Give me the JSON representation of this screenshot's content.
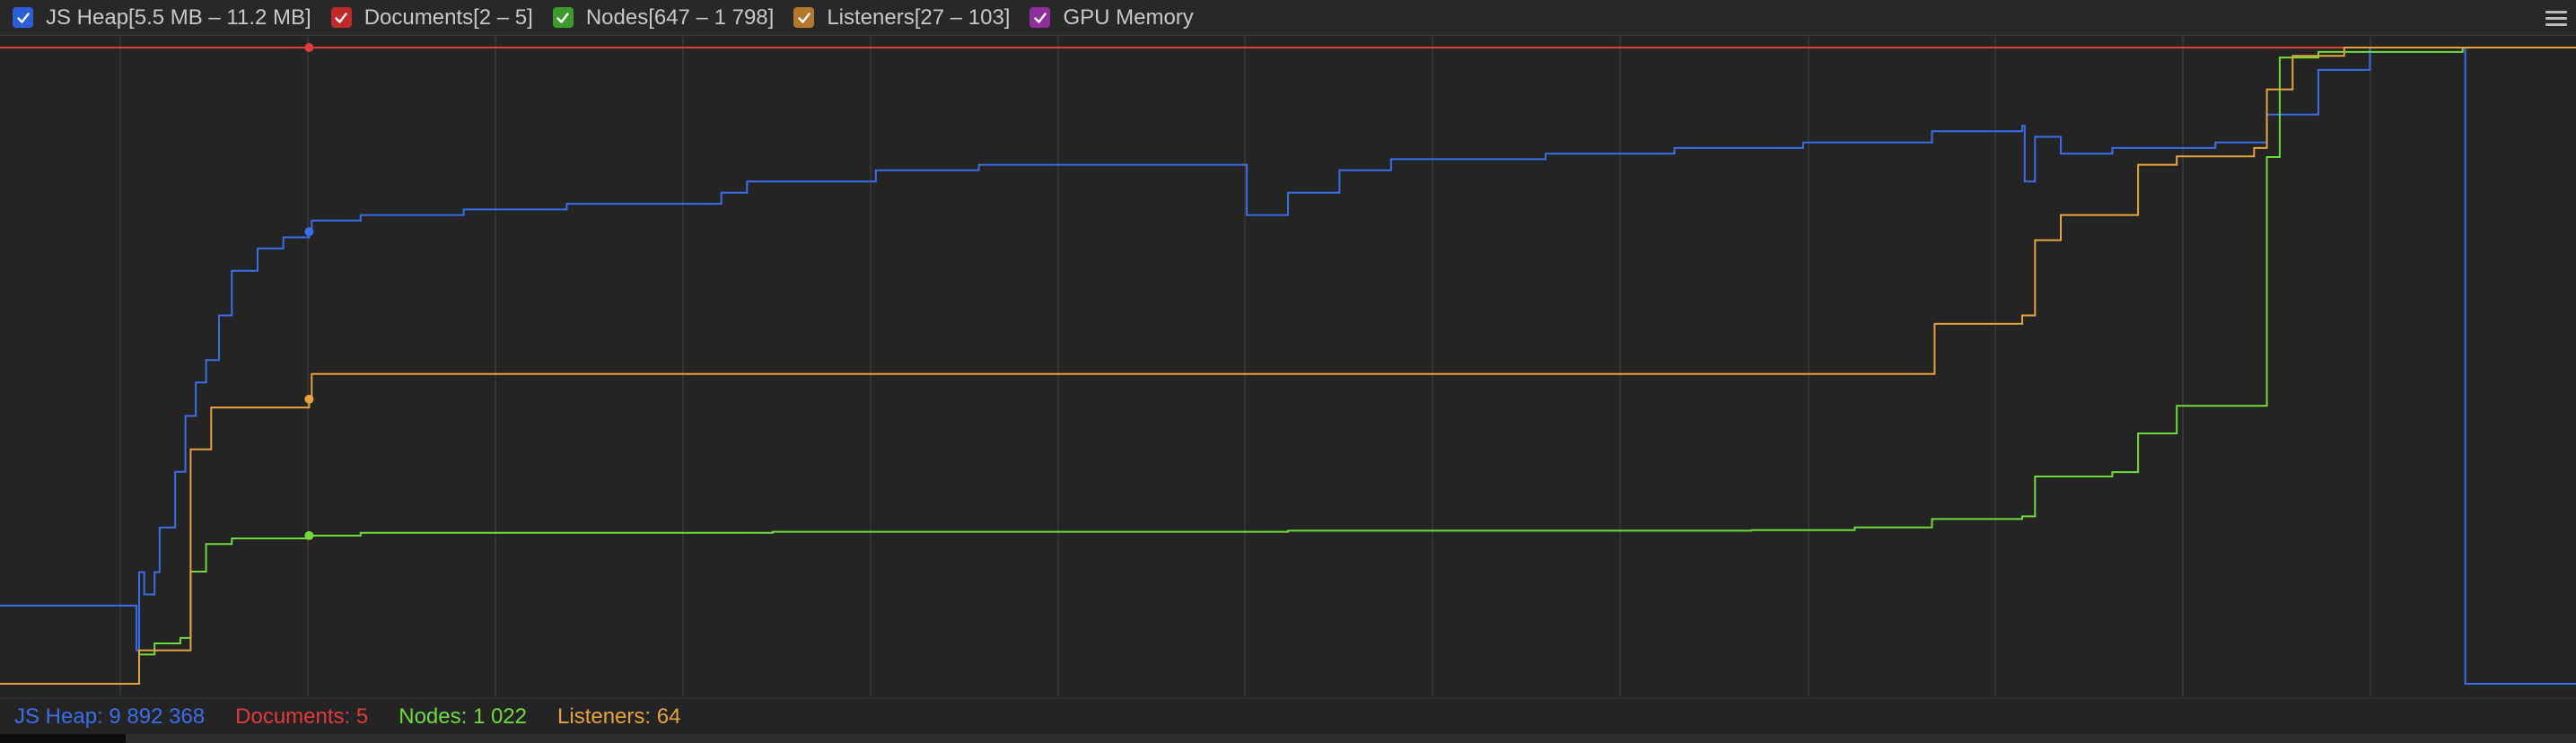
{
  "toolbar": {
    "legend": [
      {
        "label": "JS Heap[5.5 MB – 11.2 MB]",
        "color": "#2b5fd9",
        "checked": true,
        "icon": "checkmark-icon"
      },
      {
        "label": "Documents[2 – 5]",
        "color": "#c0292b",
        "checked": true,
        "icon": "checkmark-icon"
      },
      {
        "label": "Nodes[647 – 1 798]",
        "color": "#3f9a2e",
        "checked": true,
        "icon": "checkmark-icon"
      },
      {
        "label": "Listeners[27 – 103]",
        "color": "#b3782a",
        "checked": true,
        "icon": "checkmark-icon"
      },
      {
        "label": "GPU Memory",
        "color": "#8e2f9c",
        "checked": true,
        "icon": "checkmark-icon"
      }
    ],
    "menu_icon": "hamburger-menu-icon"
  },
  "status": {
    "js_heap": "JS Heap: 9 892 368",
    "documents": "Documents: 5",
    "nodes": "Nodes: 1 022",
    "listeners": "Listeners: 64"
  },
  "colors": {
    "js_heap": "#3a6ee8",
    "documents": "#e23b3b",
    "nodes": "#6fdc3c",
    "listeners": "#e8a23c",
    "gpu": "#b44bc4",
    "grid": "#3a3a3a",
    "background": "#242424"
  },
  "chart_data": {
    "type": "line",
    "xlabel": "",
    "ylabel": "",
    "grid": true,
    "marker_x": 0.12,
    "series": [
      {
        "name": "JS Heap",
        "unit": "MB",
        "range": [
          5.5,
          11.2
        ],
        "points": [
          [
            0.0,
            6.2
          ],
          [
            5.2,
            6.2
          ],
          [
            5.3,
            5.8
          ],
          [
            5.4,
            6.5
          ],
          [
            5.6,
            6.3
          ],
          [
            6.0,
            6.5
          ],
          [
            6.2,
            6.9
          ],
          [
            6.8,
            7.4
          ],
          [
            7.2,
            7.9
          ],
          [
            7.6,
            8.2
          ],
          [
            8.0,
            8.4
          ],
          [
            8.5,
            8.8
          ],
          [
            9.0,
            9.2
          ],
          [
            10.0,
            9.4
          ],
          [
            11.0,
            9.5
          ],
          [
            12.0,
            9.55
          ],
          [
            12.1,
            9.65
          ],
          [
            14.0,
            9.7
          ],
          [
            18.0,
            9.75
          ],
          [
            22.0,
            9.8
          ],
          [
            28.0,
            9.9
          ],
          [
            29.0,
            10.0
          ],
          [
            34.0,
            10.1
          ],
          [
            38.0,
            10.15
          ],
          [
            48.3,
            10.15
          ],
          [
            48.4,
            9.7
          ],
          [
            50.0,
            9.9
          ],
          [
            52.0,
            10.1
          ],
          [
            54.0,
            10.2
          ],
          [
            60.0,
            10.25
          ],
          [
            65.0,
            10.3
          ],
          [
            70.0,
            10.35
          ],
          [
            75.0,
            10.45
          ],
          [
            78.5,
            10.5
          ],
          [
            78.6,
            10.0
          ],
          [
            79.0,
            10.4
          ],
          [
            80.0,
            10.25
          ],
          [
            82.0,
            10.3
          ],
          [
            86.0,
            10.35
          ],
          [
            88.0,
            10.6
          ],
          [
            90.0,
            11.0
          ],
          [
            92.0,
            11.2
          ],
          [
            95.6,
            11.2
          ],
          [
            95.7,
            5.5
          ],
          [
            100.0,
            5.5
          ]
        ]
      },
      {
        "name": "Documents",
        "range": [
          2,
          5
        ],
        "points": [
          [
            0.0,
            5
          ],
          [
            100.0,
            5
          ]
        ]
      },
      {
        "name": "Nodes",
        "range": [
          647,
          1798
        ],
        "points": [
          [
            0.0,
            647
          ],
          [
            5.2,
            647
          ],
          [
            5.4,
            700
          ],
          [
            6.0,
            720
          ],
          [
            7.0,
            730
          ],
          [
            7.4,
            850
          ],
          [
            8.0,
            900
          ],
          [
            9.0,
            910
          ],
          [
            12.0,
            915
          ],
          [
            14.0,
            920
          ],
          [
            30.0,
            922
          ],
          [
            50.0,
            924
          ],
          [
            68.0,
            925
          ],
          [
            72.0,
            930
          ],
          [
            75.0,
            945
          ],
          [
            78.5,
            950
          ],
          [
            79.0,
            1022
          ],
          [
            82.0,
            1030
          ],
          [
            83.0,
            1100
          ],
          [
            84.5,
            1150
          ],
          [
            87.5,
            1150
          ],
          [
            88.0,
            1600
          ],
          [
            88.5,
            1780
          ],
          [
            90.0,
            1790
          ],
          [
            95.6,
            1798
          ],
          [
            100.0,
            1798
          ]
        ]
      },
      {
        "name": "Listeners",
        "range": [
          27,
          103
        ],
        "points": [
          [
            0.0,
            27
          ],
          [
            5.2,
            27
          ],
          [
            5.4,
            31
          ],
          [
            7.0,
            31
          ],
          [
            7.4,
            55
          ],
          [
            8.2,
            60
          ],
          [
            12.0,
            61
          ],
          [
            12.1,
            64
          ],
          [
            75.0,
            64
          ],
          [
            75.1,
            70
          ],
          [
            78.5,
            71
          ],
          [
            79.0,
            80
          ],
          [
            80.0,
            83
          ],
          [
            83.0,
            89
          ],
          [
            84.5,
            90
          ],
          [
            87.5,
            91
          ],
          [
            88.0,
            98
          ],
          [
            89.0,
            102
          ],
          [
            91.0,
            103
          ],
          [
            100.0,
            103
          ]
        ]
      }
    ]
  }
}
